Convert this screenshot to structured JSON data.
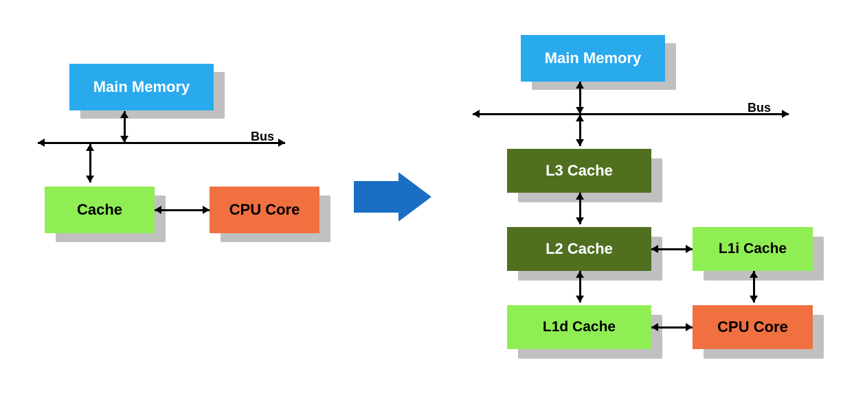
{
  "left": {
    "main_memory": "Main Memory",
    "cache": "Cache",
    "cpu_core": "CPU Core",
    "bus_label": "Bus"
  },
  "right": {
    "main_memory": "Main Memory",
    "l3_cache": "L3 Cache",
    "l2_cache": "L2 Cache",
    "l1i_cache": "L1i Cache",
    "l1d_cache": "L1d Cache",
    "cpu_core": "CPU Core",
    "bus_label": "Bus"
  }
}
